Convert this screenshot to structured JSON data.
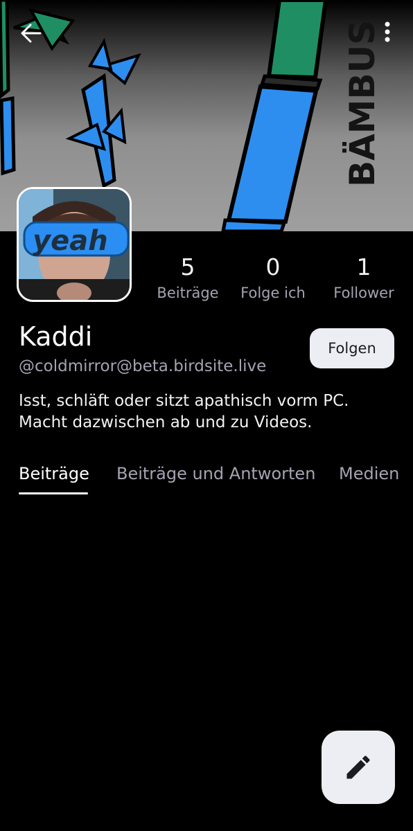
{
  "colors": {
    "background": "#000000",
    "muted_text": "#a4a4b2",
    "button_bg": "#eceef4",
    "bamboo_blue": "#2d8ef0",
    "bamboo_green": "#1f8f63"
  },
  "banner": {
    "drawing_text": "BÄMBUS"
  },
  "toolbar": {
    "back_icon": "arrow-left-icon",
    "menu_icon": "more-vertical-icon"
  },
  "avatar": {
    "glasses_text": "yeah"
  },
  "stats": {
    "posts": {
      "value": "5",
      "label": "Beiträge"
    },
    "following": {
      "value": "0",
      "label": "Folge ich"
    },
    "followers": {
      "value": "1",
      "label": "Follower"
    }
  },
  "profile": {
    "name": "Kaddi",
    "handle": "@coldmirror@beta.birdsite.live",
    "bio": "Isst, schläft oder sitzt apathisch vorm PC. Macht dazwischen ab und zu Videos."
  },
  "follow_button": {
    "label": "Folgen"
  },
  "tabs": [
    {
      "label": "Beiträge",
      "active": true
    },
    {
      "label": "Beiträge und Antworten",
      "active": false
    },
    {
      "label": "Medien",
      "active": false
    }
  ],
  "fab": {
    "icon": "pencil-icon"
  }
}
